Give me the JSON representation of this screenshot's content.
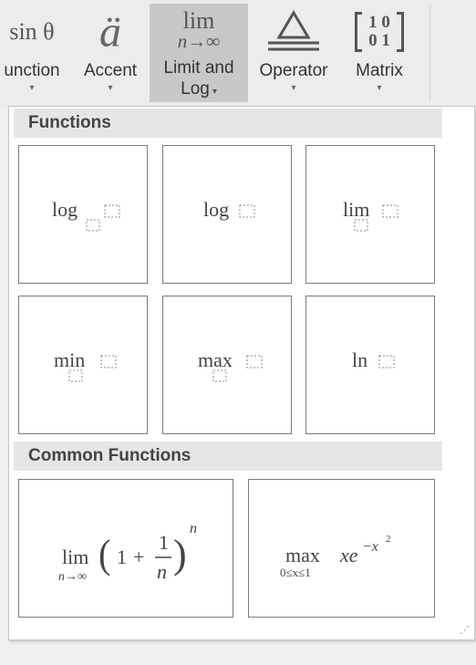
{
  "ribbon": {
    "buttons": [
      {
        "id": "function",
        "label_line1": "unction",
        "label_line2": "",
        "glyph": "sin θ"
      },
      {
        "id": "accent",
        "label_line1": "Accent",
        "label_line2": "",
        "glyph": "ä"
      },
      {
        "id": "limit_log",
        "label_line1": "Limit and",
        "label_line2": "Log",
        "glyph_top": "lim",
        "glyph_bottom": "n→∞"
      },
      {
        "id": "operator",
        "label_line1": "Operator",
        "label_line2": "",
        "glyph": "Δ"
      },
      {
        "id": "matrix",
        "label_line1": "Matrix",
        "label_line2": "",
        "glyph_row1": "1 0",
        "glyph_row2": "0 1"
      }
    ],
    "caret": "▾"
  },
  "gallery": {
    "sections": [
      {
        "title": "Functions"
      },
      {
        "title": "Common Functions"
      }
    ],
    "tiles": {
      "log_base": {
        "fn": "log"
      },
      "log": {
        "fn": "log"
      },
      "lim": {
        "fn": "lim"
      },
      "min": {
        "fn": "min"
      },
      "max": {
        "fn": "max"
      },
      "ln": {
        "fn": "ln"
      },
      "limit_e": {
        "fn": "lim",
        "sub": "n→∞",
        "one": "1",
        "plus": "+",
        "num": "1",
        "den": "n",
        "exp": "n"
      },
      "max_xe": {
        "fn": "max",
        "sub": "0≤x≤1",
        "body": "xe",
        "exp": "−x",
        "exp2": "2"
      }
    },
    "resize_grip": "⋰"
  }
}
